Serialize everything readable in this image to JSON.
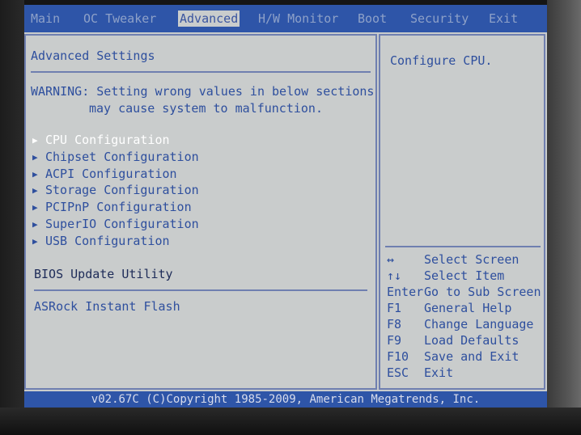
{
  "menubar": {
    "tabs": [
      {
        "label": "Main"
      },
      {
        "label": "OC Tweaker"
      },
      {
        "label": "Advanced"
      },
      {
        "label": "H/W Monitor"
      },
      {
        "label": "Boot"
      },
      {
        "label": "Security"
      },
      {
        "label": "Exit"
      }
    ],
    "active": "Advanced"
  },
  "left_panel": {
    "title": "Advanced Settings",
    "warning_line1": "WARNING: Setting wrong values in below sections",
    "warning_line2": "may cause system to malfunction.",
    "items": [
      {
        "label": "CPU Configuration",
        "selected": true
      },
      {
        "label": "Chipset Configuration"
      },
      {
        "label": "ACPI Configuration"
      },
      {
        "label": "Storage Configuration"
      },
      {
        "label": "PCIPnP Configuration"
      },
      {
        "label": "SuperIO Configuration"
      },
      {
        "label": "USB Configuration"
      }
    ],
    "section_title": "BIOS Update Utility",
    "section_item": "ASRock Instant Flash"
  },
  "right_panel": {
    "help_text": "Configure CPU.",
    "keys": [
      {
        "key": "↔",
        "action": "Select Screen"
      },
      {
        "key": "↑↓",
        "action": "Select Item"
      },
      {
        "key": "Enter",
        "action": "Go to Sub Screen"
      },
      {
        "key": "F1",
        "action": "General Help"
      },
      {
        "key": "F8",
        "action": "Change Language"
      },
      {
        "key": "F9",
        "action": "Load Defaults"
      },
      {
        "key": "F10",
        "action": "Save and Exit"
      },
      {
        "key": "ESC",
        "action": "Exit"
      }
    ]
  },
  "statusbar": {
    "text": "v02.67C (C)Copyright 1985-2009, American Megatrends, Inc."
  },
  "colors": {
    "bar_blue": "#2e55a8",
    "screen_grey": "#c9cccc",
    "text_blue": "#2e4f9e",
    "selected_text": "#ffffff"
  }
}
